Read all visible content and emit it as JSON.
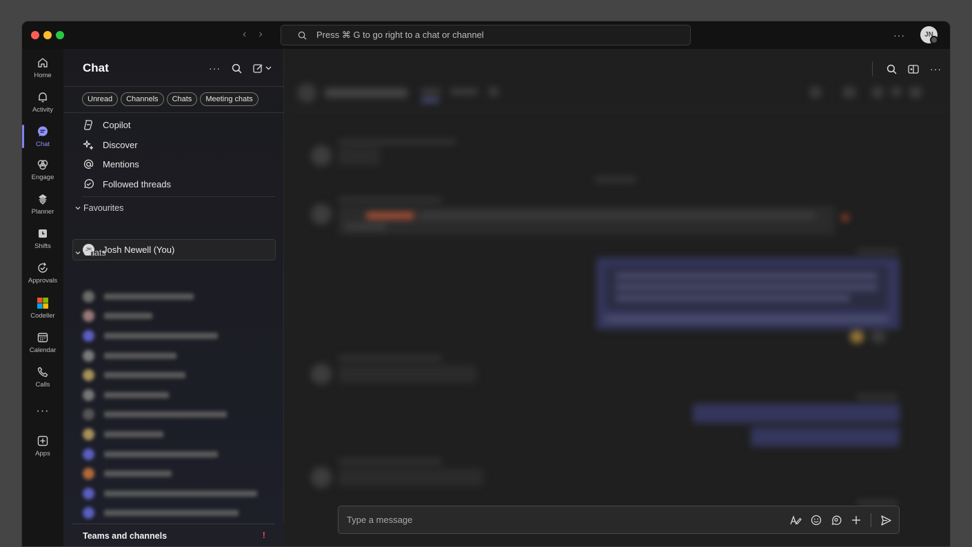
{
  "search": {
    "placeholder": "Press ⌘ G to go right to a chat or channel"
  },
  "user": {
    "initials": "JN"
  },
  "rail": [
    {
      "label": "Home",
      "icon": "home-icon"
    },
    {
      "label": "Activity",
      "icon": "bell-icon"
    },
    {
      "label": "Chat",
      "icon": "chat-icon",
      "active": true
    },
    {
      "label": "Engage",
      "icon": "engage-icon"
    },
    {
      "label": "Planner",
      "icon": "planner-icon"
    },
    {
      "label": "Shifts",
      "icon": "shifts-icon"
    },
    {
      "label": "Approvals",
      "icon": "approvals-icon"
    },
    {
      "label": "Codeller",
      "icon": "codeller-icon"
    },
    {
      "label": "Calendar",
      "icon": "calendar-icon"
    },
    {
      "label": "Calls",
      "icon": "phone-icon"
    },
    {
      "label": "",
      "icon": "more-icon"
    },
    {
      "label": "Apps",
      "icon": "apps-icon"
    }
  ],
  "panel": {
    "title": "Chat",
    "filters": [
      "Unread",
      "Channels",
      "Chats",
      "Meeting chats"
    ],
    "menu": [
      "Copilot",
      "Discover",
      "Mentions",
      "Followed threads"
    ],
    "favourites_label": "Favourites",
    "favourite": "Josh Newell (You)",
    "chats_label": "Chats",
    "teams_label": "Teams and channels",
    "teams_alert": "!"
  },
  "composer": {
    "placeholder": "Type a message"
  },
  "colors": {
    "accent": "#7f85f5",
    "alert": "#e74856"
  }
}
